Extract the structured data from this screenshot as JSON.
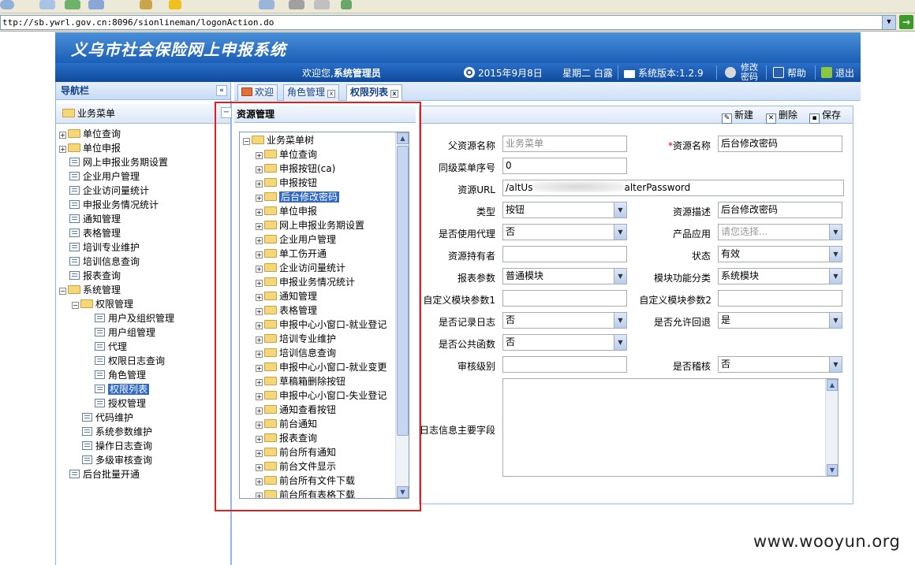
{
  "browser": {
    "address": "ttp://sb.ywrl.gov.cn:8096/sionlineman/logonAction.do",
    "go_label": "→"
  },
  "app": {
    "title": "义乌市社会保险网上申报系统",
    "welcome_prefix": "欢迎您,",
    "user": "系统管理员",
    "date": "2015年9月8日",
    "weekday": "星期二 白露",
    "version": "系统版本:1.2.9",
    "change_password_line1": "修改",
    "change_password_line2": "密码",
    "help": "帮助",
    "logout": "退出"
  },
  "nav": {
    "title": "导航栏",
    "collapse_label": "«",
    "section": "业务菜单",
    "items": [
      {
        "label": "单位查询",
        "type": "folder",
        "depth": 0,
        "expand": "+"
      },
      {
        "label": "单位申报",
        "type": "folder",
        "depth": 0,
        "expand": "+"
      },
      {
        "label": "网上申报业务期设置",
        "type": "doc",
        "depth": 0
      },
      {
        "label": "企业用户管理",
        "type": "doc",
        "depth": 0
      },
      {
        "label": "企业访问量统计",
        "type": "doc",
        "depth": 0
      },
      {
        "label": "申报业务情况统计",
        "type": "doc",
        "depth": 0
      },
      {
        "label": "通知管理",
        "type": "doc",
        "depth": 0
      },
      {
        "label": "表格管理",
        "type": "doc",
        "depth": 0
      },
      {
        "label": "培训专业维护",
        "type": "doc",
        "depth": 0
      },
      {
        "label": "培训信息查询",
        "type": "doc",
        "depth": 0
      },
      {
        "label": "报表查询",
        "type": "doc",
        "depth": 0
      },
      {
        "label": "系统管理",
        "type": "folder",
        "depth": 0,
        "expand": "−"
      },
      {
        "label": "权限管理",
        "type": "folder",
        "depth": 1,
        "expand": "−"
      },
      {
        "label": "用户及组织管理",
        "type": "doc",
        "depth": 2
      },
      {
        "label": "用户组管理",
        "type": "doc",
        "depth": 2
      },
      {
        "label": "代理",
        "type": "doc",
        "depth": 2
      },
      {
        "label": "权限日志查询",
        "type": "doc",
        "depth": 2
      },
      {
        "label": "角色管理",
        "type": "doc",
        "depth": 2
      },
      {
        "label": "权限列表",
        "type": "doc",
        "depth": 2,
        "selected": true
      },
      {
        "label": "授权管理",
        "type": "doc",
        "depth": 2
      },
      {
        "label": "代码维护",
        "type": "doc",
        "depth": 1
      },
      {
        "label": "系统参数维护",
        "type": "doc",
        "depth": 1
      },
      {
        "label": "操作日志查询",
        "type": "doc",
        "depth": 1
      },
      {
        "label": "多级审核查询",
        "type": "doc",
        "depth": 1
      },
      {
        "label": "后台批量开通",
        "type": "doc",
        "depth": 0
      }
    ]
  },
  "tabs": [
    {
      "label": "欢迎",
      "closable": false
    },
    {
      "label": "角色管理",
      "closable": true
    },
    {
      "label": "权限列表",
      "closable": true,
      "active": true
    }
  ],
  "resource": {
    "title": "资源管理",
    "collapse_label": "−",
    "root": "业务菜单树",
    "items": [
      "单位查询",
      "申报按钮(ca)",
      "申报按钮",
      "后台修改密码",
      "单位申报",
      "网上申报业务期设置",
      "企业用户管理",
      "单工伤开通",
      "企业访问量统计",
      "申报业务情况统计",
      "通知管理",
      "表格管理",
      "申报中心小窗口-就业登记",
      "培训专业维护",
      "培训信息查询",
      "申报中心小窗口-就业变更",
      "草稿箱删除按钮",
      "申报中心小窗口-失业登记",
      "通知查看按钮",
      "前台通知",
      "报表查询",
      "前台所有通知",
      "前台文件显示",
      "前台所有文件下载",
      "前台所有表格下载"
    ],
    "selected": "后台修改密码"
  },
  "form": {
    "buttons": {
      "new": "新建",
      "delete": "删除",
      "save": "保存"
    },
    "parent_label": "父资源名称",
    "parent_value": "业务菜单",
    "name_label": "资源名称",
    "name_required": "*",
    "name_value": "后台修改密码",
    "sort_label": "同级菜单序号",
    "sort_value": "0",
    "url_label": "资源URL",
    "url_prefix": "/altUs",
    "url_suffix": "alterPassword",
    "type_label": "类型",
    "type_value": "按钮",
    "desc_label": "资源描述",
    "desc_value": "后台修改密码",
    "proxy_label": "是否使用代理",
    "proxy_value": "否",
    "product_label": "产品应用",
    "product_placeholder": "请您选择...",
    "holder_label": "资源持有者",
    "holder_value": "",
    "status_label": "状态",
    "status_value": "有效",
    "report_label": "报表参数",
    "report_value": "普通模块",
    "category_label": "模块功能分类",
    "category_value": "系统模块",
    "custom1_label": "自定义模块参数1",
    "custom1_value": "",
    "custom2_label": "自定义模块参数2",
    "custom2_value": "",
    "log_label": "是否记录日志",
    "log_value": "否",
    "rollback_label": "是否允许回退",
    "rollback_value": "是",
    "public_label": "是否公共函数",
    "public_value": "否",
    "audit_label": "审核级别",
    "audit_value": "",
    "check_label": "是否稽核",
    "check_value": "否",
    "logfields_label": "日志信息主要字段"
  },
  "watermark": "www.wooyun.org"
}
